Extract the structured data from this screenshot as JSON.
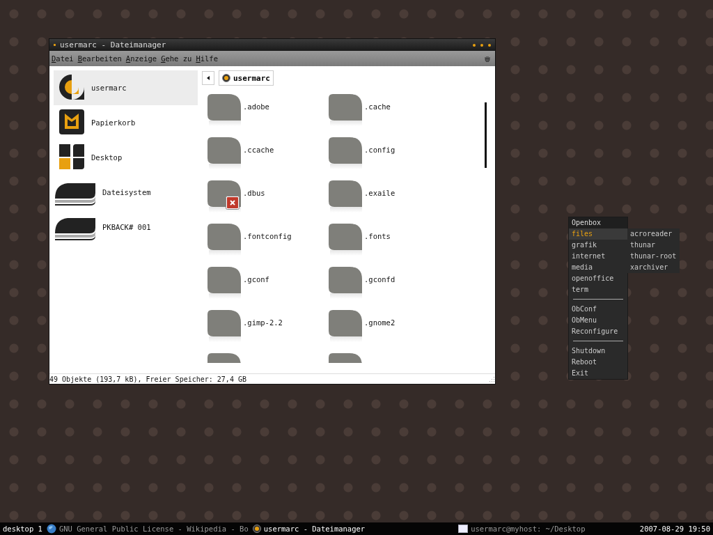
{
  "window": {
    "title": "usermarc - Dateimanager"
  },
  "menu_bar": [
    "Datei",
    "Bearbeiten",
    "Anzeige",
    "Gehe zu",
    "Hilfe"
  ],
  "sidebar": {
    "items": [
      {
        "label": "usermarc",
        "kind": "home",
        "selected": true
      },
      {
        "label": "Papierkorb",
        "kind": "trash",
        "selected": false
      },
      {
        "label": "Desktop",
        "kind": "desktop",
        "selected": false
      },
      {
        "label": "Dateisystem",
        "kind": "drive",
        "selected": false
      },
      {
        "label": "PKBACK# 001",
        "kind": "drive",
        "selected": false
      }
    ]
  },
  "path_bar": {
    "location": "usermarc"
  },
  "files": [
    {
      "name": ".adobe"
    },
    {
      "name": ".cache"
    },
    {
      "name": ".ccache"
    },
    {
      "name": ".config"
    },
    {
      "name": ".dbus",
      "error": true
    },
    {
      "name": ".exaile"
    },
    {
      "name": ".fontconfig"
    },
    {
      "name": ".fonts"
    },
    {
      "name": ".gconf"
    },
    {
      "name": ".gconfd"
    },
    {
      "name": ".gimp-2.2"
    },
    {
      "name": ".gnome2"
    }
  ],
  "status_bar": "49 Objekte (193,7 kB), Freier Speicher: 27,4 GB",
  "openbox_menu": {
    "title": "Openbox",
    "items": [
      {
        "kind": "item",
        "label": "files",
        "selected": true
      },
      {
        "kind": "item",
        "label": "grafik",
        "selected": false
      },
      {
        "kind": "item",
        "label": "internet",
        "selected": false
      },
      {
        "kind": "item",
        "label": "media",
        "selected": false
      },
      {
        "kind": "item",
        "label": "openoffice",
        "selected": false
      },
      {
        "kind": "item",
        "label": "term",
        "selected": false
      },
      {
        "kind": "separator"
      },
      {
        "kind": "item",
        "label": "ObConf",
        "selected": false
      },
      {
        "kind": "item",
        "label": "ObMenu",
        "selected": false
      },
      {
        "kind": "item",
        "label": "Reconfigure",
        "selected": false
      },
      {
        "kind": "separator"
      },
      {
        "kind": "item",
        "label": "Shutdown",
        "selected": false
      },
      {
        "kind": "item",
        "label": "Reboot",
        "selected": false
      },
      {
        "kind": "item",
        "label": "Exit",
        "selected": false
      }
    ],
    "submenu": [
      "acroreader",
      "thunar",
      "thunar-root",
      "xarchiver"
    ]
  },
  "taskbar": {
    "desktop": "desktop 1",
    "tasks": [
      {
        "kind": "browser",
        "label": "GNU General Public License - Wikipedia - Bo",
        "selected": false
      },
      {
        "kind": "filemanager",
        "label": "usermarc - Dateimanager",
        "selected": true
      },
      {
        "kind": "terminal",
        "label": "usermarc@myhost: ~/Desktop",
        "selected": false
      }
    ],
    "clock": "2007-08-29 19:50"
  }
}
